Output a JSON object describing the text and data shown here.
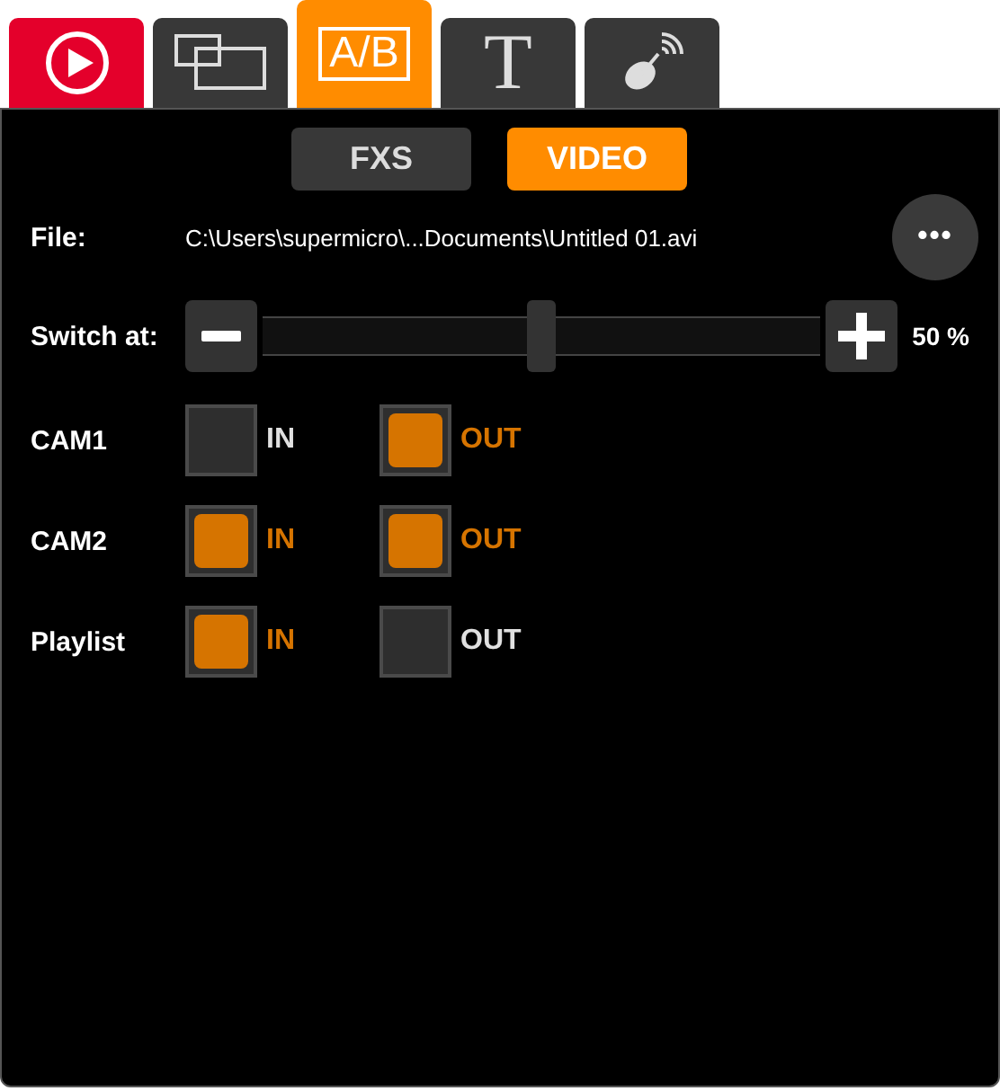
{
  "tabs": [
    {
      "kind": "play",
      "color": "#e4002b",
      "selected": false
    },
    {
      "kind": "windows",
      "color": "#383838",
      "selected": false
    },
    {
      "kind": "ab",
      "glyph": "A/B",
      "color": "#ff8c00",
      "selected": true
    },
    {
      "kind": "text",
      "glyph": "T",
      "color": "#383838",
      "selected": false
    },
    {
      "kind": "satellite",
      "color": "#383838",
      "selected": false
    }
  ],
  "modes": [
    {
      "label": "FXS",
      "selected": false
    },
    {
      "label": "VIDEO",
      "selected": true
    }
  ],
  "file": {
    "label": "File:",
    "path": "C:\\Users\\supermicro\\...Documents\\Untitled 01.avi",
    "more": "•••"
  },
  "switch": {
    "label": "Switch at:",
    "level": 0.5,
    "reading": "50 %"
  },
  "sources": [
    {
      "name": "CAM1",
      "in": {
        "label": "IN",
        "checked": false
      },
      "out": {
        "label": "OUT",
        "checked": true
      }
    },
    {
      "name": "CAM2",
      "in": {
        "label": "IN",
        "checked": true
      },
      "out": {
        "label": "OUT",
        "checked": true
      }
    },
    {
      "name": "Playlist",
      "in": {
        "label": "IN",
        "checked": true
      },
      "out": {
        "label": "OUT",
        "checked": false
      }
    }
  ]
}
